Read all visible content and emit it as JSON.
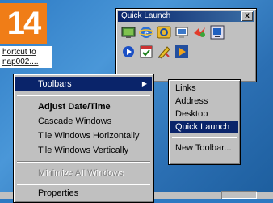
{
  "badge": {
    "step": "14",
    "color": "#f07d17"
  },
  "shortcut": {
    "line1": "hortcut to",
    "line2": "nap002...."
  },
  "quick_launch": {
    "title": "Quick Launch",
    "close_label": "x",
    "icons_row1": [
      "desktop-icon",
      "ie-icon",
      "outlook-icon",
      "media-icon",
      "messenger-icon",
      "channels-icon"
    ],
    "icons_row2": [
      "realplayer-icon",
      "calendar-icon",
      "pen-icon",
      "winamp-icon"
    ]
  },
  "menu": {
    "toolbars": "Toolbars",
    "adjust_date_time": "Adjust Date/Time",
    "cascade": "Cascade Windows",
    "tile_h": "Tile Windows Horizontally",
    "tile_v": "Tile Windows Vertically",
    "minimize_all": "Minimize All Windows",
    "properties": "Properties"
  },
  "submenu": {
    "links": "Links",
    "address": "Address",
    "desktop": "Desktop",
    "quick_launch": "Quick Launch",
    "new_toolbar": "New Toolbar..."
  },
  "colors": {
    "highlight": "#0a246a",
    "menu_bg": "#c0c0c0",
    "desktop": "#2f7cc5"
  }
}
